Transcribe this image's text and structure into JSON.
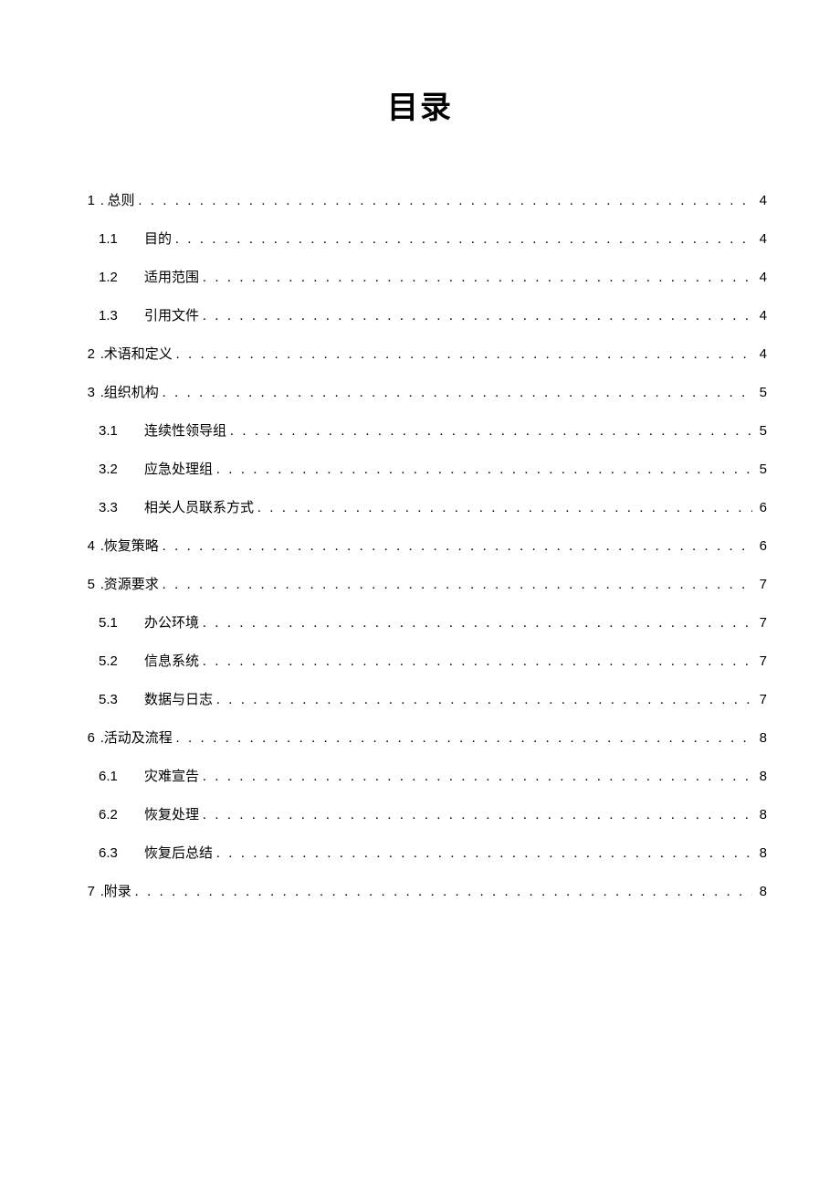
{
  "title": "目录",
  "entries": [
    {
      "level": 1,
      "num": "1",
      "title": ". 总则",
      "page": "4"
    },
    {
      "level": 2,
      "num": "1.1",
      "title": "目的",
      "page": "4"
    },
    {
      "level": 2,
      "num": "1.2",
      "title": "适用范围",
      "page": "4"
    },
    {
      "level": 2,
      "num": "1.3",
      "title": "引用文件",
      "page": "4"
    },
    {
      "level": 1,
      "num": "2",
      "title": ".术语和定义",
      "page": "4"
    },
    {
      "level": 1,
      "num": "3",
      "title": ".组织机构",
      "page": "5"
    },
    {
      "level": 2,
      "num": "3.1",
      "title": "连续性领导组",
      "page": "5"
    },
    {
      "level": 2,
      "num": "3.2",
      "title": "应急处理组",
      "page": "5"
    },
    {
      "level": 2,
      "num": "3.3",
      "title": "相关人员联系方式",
      "page": "6"
    },
    {
      "level": 1,
      "num": "4",
      "title": ".恢复策略",
      "page": "6"
    },
    {
      "level": 1,
      "num": "5",
      "title": ".资源要求",
      "page": "7"
    },
    {
      "level": 2,
      "num": "5.1",
      "title": "办公环境",
      "page": "7"
    },
    {
      "level": 2,
      "num": "5.2",
      "title": "信息系统",
      "page": "7"
    },
    {
      "level": 2,
      "num": "5.3",
      "title": "数据与日志",
      "page": "7"
    },
    {
      "level": 1,
      "num": "6",
      "title": ".活动及流程",
      "page": "8"
    },
    {
      "level": 2,
      "num": "6.1",
      "title": "灾难宣告",
      "page": "8"
    },
    {
      "level": 2,
      "num": "6.2",
      "title": "恢复处理",
      "page": "8"
    },
    {
      "level": 2,
      "num": "6.3",
      "title": "恢复后总结",
      "page": "8"
    },
    {
      "level": 1,
      "num": "7",
      "title": ".附录",
      "page": "8"
    }
  ]
}
